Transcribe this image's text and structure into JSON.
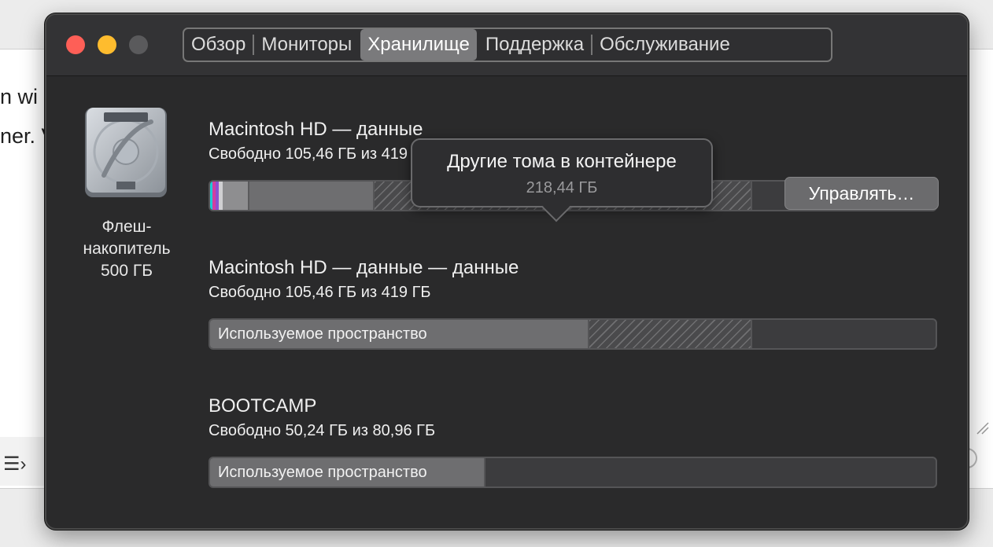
{
  "background_doc": {
    "line1": "n wi",
    "line2": "ner. V",
    "list_icon": "☰›"
  },
  "window": {
    "tabs": [
      {
        "label": "Обзор",
        "active": false
      },
      {
        "label": "Мониторы",
        "active": false
      },
      {
        "label": "Хранилище",
        "active": true
      },
      {
        "label": "Поддержка",
        "active": false
      },
      {
        "label": "Обслуживание",
        "active": false
      }
    ]
  },
  "drive": {
    "icon": "hard-drive-icon",
    "label_line1": "Флеш-",
    "label_line2": "накопитель",
    "label_line3": "500 ГБ"
  },
  "volumes": [
    {
      "name": "Macintosh HD — данные",
      "free": "Свободно 105,46 ГБ из 419 ГБ",
      "bar_label": ""
    },
    {
      "name": "Macintosh HD — данные — данные",
      "free": "Свободно 105,46 ГБ из 419 ГБ",
      "bar_label": "Используемое пространство"
    },
    {
      "name": "BOOTCAMP",
      "free": "Свободно 50,24 ГБ из 80,96 ГБ",
      "bar_label": "Используемое пространство"
    }
  ],
  "manage_button": "Управлять…",
  "tooltip": {
    "title": "Другие тома в контейнере",
    "value": "218,44 ГБ"
  },
  "colors": {
    "close": "#fe5f57",
    "minimize": "#febc2e",
    "window_bg": "#2a2a2b"
  }
}
